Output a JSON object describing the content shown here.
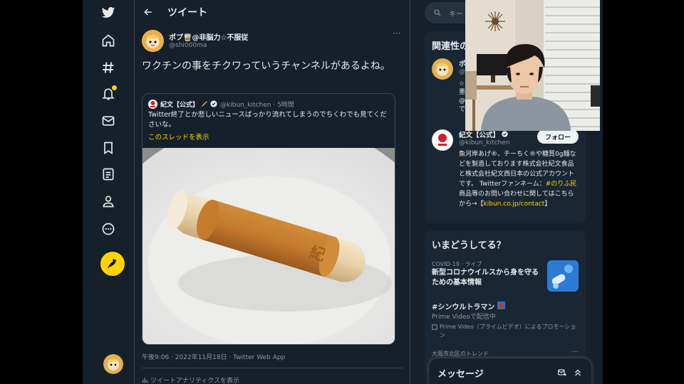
{
  "header": {
    "title": "ツイート"
  },
  "nav": {
    "items": [
      "twitter-logo",
      "home",
      "explore",
      "notifications",
      "messages",
      "bookmarks",
      "lists",
      "profile",
      "more"
    ],
    "accent": "#ffd400"
  },
  "tweet": {
    "author_name": "ポプ🥃@非脳力☆不服従",
    "author_handle": "@shi000ma",
    "text": "ワクチンの事をチクワっていうチャンネルがあるよね。",
    "meta": "午後9:06 · 2022年11月18日 · Twitter Web App",
    "analytics": "ツイートアナリティクスを表示"
  },
  "quote": {
    "name": "紀文【公式】",
    "handle": "@kibun_kitchen · 5時間",
    "text": "Twitter終了とか悲しいニュースばっかり流れてしまうのでちくわでも見てくださいな。",
    "link": "このスレッドを表示"
  },
  "search": {
    "placeholder": "キー"
  },
  "related": {
    "title": "関連性の",
    "user1_name": "ポ",
    "user1_handle": "@",
    "user1_bio": "☆\n墨\n@\nで",
    "user2_name": "紀文【公式】",
    "user2_handle": "@kibun_kitchen",
    "follow_label": "フォロー",
    "bio_part1": "魚河岸あげ®、チーちく®や糖質0g麺などを製造しております株式会社紀文食品と株式会社紀文西日本の公式アカウントです。 Twitterファンネーム：",
    "bio_hashtag": "#のりふ民",
    "bio_part2": " 商品等のお問い合わせに関してはこちらから→【",
    "bio_link": "kibun.co.jp/contact",
    "bio_end": "】"
  },
  "trends": {
    "title": "いまどうしてる？",
    "t1_meta": "COVID-19 · ライブ",
    "t1_title": "新型コロナウイルスから身を守るための基本情報",
    "t2_title": "#シンウルトラマン",
    "t2_sub": "Prime Videoで配信中",
    "t2_promo": "Prime Video（プライムビデオ）によるプロモーション",
    "t3_meta": "大阪市北区のトレンド"
  },
  "messages": {
    "title": "メッセージ"
  }
}
